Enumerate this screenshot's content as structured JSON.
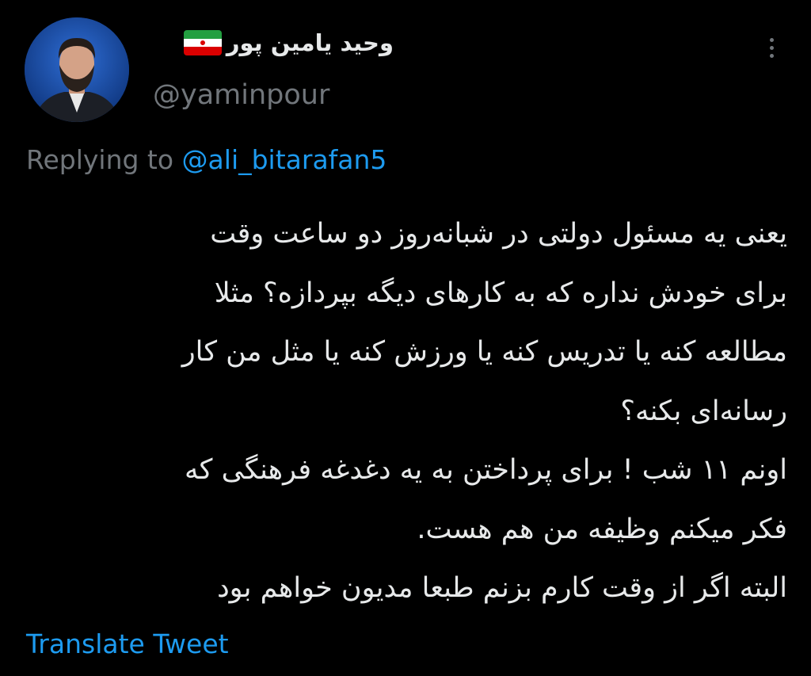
{
  "author": {
    "display_name": "وحید یامین پور",
    "flag_icon": "iran-flag-icon",
    "handle": "@yaminpour"
  },
  "more_icon": "more-dots-icon",
  "reply": {
    "prefix": "Replying to ",
    "mention": "@ali_bitarafan5"
  },
  "tweet_lines": [
    "یعنی یه مسئول دولتی در شبانه‌روز دو ساعت وقت",
    "برای خودش نداره که به کارهای دیگه بپردازه؟ مثلا",
    "مطالعه کنه یا تدریس کنه یا ورزش کنه یا مثل من کار",
    "رسانه‌ای بکنه؟",
    "اونم ۱۱ شب ! برای پرداختن به یه دغدغه فرهنگی که",
    "فکر میکنم وظیفه من هم هست.",
    "البته اگر از وقت کارم بزنم طبعا مدیون خواهم بود"
  ],
  "translate_label": "Translate Tweet",
  "colors": {
    "background": "#000000",
    "text": "#e7e9ea",
    "secondary": "#71767b",
    "accent": "#1d9bf0"
  }
}
